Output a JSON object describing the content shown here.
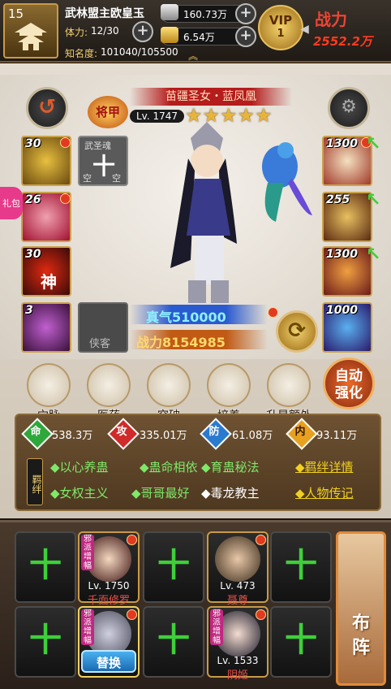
{
  "player": {
    "level": "15",
    "name": "武林盟主欧皇玉",
    "stamina_label": "体力:",
    "stamina": "12/30",
    "fame_label": "知名度:",
    "fame": "101040/105500",
    "silver": "160.73万",
    "gold": "6.54万",
    "vip_label": "VIP",
    "vip_level": "1",
    "power_logo": "战力",
    "power": "2552.2万"
  },
  "hero": {
    "title": "苗疆圣女・蓝凤凰",
    "badge": "将甲",
    "level": "Lv. 1747",
    "stars": 5,
    "true_qi": "真气510000",
    "combat_power": "战力8154985"
  },
  "left_slots": [
    {
      "count": "30",
      "icon": "gold-ring-icon"
    },
    {
      "count": "26",
      "icon": "skull-icon"
    },
    {
      "count": "30",
      "icon": "divine-slash-icon",
      "text": "神"
    },
    {
      "count": "3",
      "icon": "purple-orb-icon"
    }
  ],
  "spirit_slot": {
    "label": "武圣魂",
    "empty": "空",
    "plus": "十"
  },
  "gift_label": "礼包",
  "right_slots": [
    {
      "count": "1300",
      "icon": "feather-icon"
    },
    {
      "count": "255",
      "icon": "armor-icon"
    },
    {
      "count": "1300",
      "icon": "mirror-icon"
    },
    {
      "count": "1000",
      "icon": "phoenix-icon"
    }
  ],
  "guest_slot": "侠客",
  "actions": [
    {
      "label": "穴脉",
      "icon": "meridian-icon"
    },
    {
      "label": "医药",
      "icon": "medicine-icon"
    },
    {
      "label": "突破",
      "icon": "breakthrough-icon"
    },
    {
      "label": "培养",
      "icon": "cultivate-icon"
    },
    {
      "label": "升星额外",
      "icon": "star-up-icon"
    }
  ],
  "auto_enhance": "自动\n强化",
  "stats": [
    {
      "char": "命",
      "value": "538.3万",
      "color": "#2ea83a"
    },
    {
      "char": "攻",
      "value": "335.01万",
      "color": "#d02a2a"
    },
    {
      "char": "防",
      "value": "61.08万",
      "color": "#2a7ad0"
    },
    {
      "char": "内",
      "value": "93.11万",
      "color": "#e8a020"
    }
  ],
  "bonds_label": "羁绊",
  "bonds": [
    {
      "text": "◆以心养蛊",
      "active": true
    },
    {
      "text": "◆蛊命相依",
      "active": true
    },
    {
      "text": "◆育蛊秘法",
      "active": true
    },
    {
      "text": "◆女权主义",
      "active": true
    },
    {
      "text": "◆哥哥最好",
      "active": true
    },
    {
      "text": "◆毒龙教主",
      "active": false
    }
  ],
  "links": {
    "bond_detail": "◆羁绊详情",
    "biography": "◆人物传记"
  },
  "team": [
    {
      "empty": true
    },
    {
      "empty": false,
      "level": "Lv. 1750",
      "name": "千面修罗",
      "tag": "邪派增幅"
    },
    {
      "empty": true
    },
    {
      "empty": false,
      "level": "Lv. 473",
      "name": "聂尊",
      "tag": ""
    },
    {
      "empty": true
    },
    {
      "empty": true
    },
    {
      "empty": false,
      "level": "",
      "name": "",
      "tag": "邪派增幅",
      "replace": "替换"
    },
    {
      "empty": true
    },
    {
      "empty": false,
      "level": "Lv. 1533",
      "name": "阴姬",
      "tag": "邪派增幅"
    },
    {
      "empty": true
    }
  ],
  "formation": "布\n阵",
  "plus_glyph": "十",
  "colors": {
    "accent": "#c89a48",
    "power": "#ff3a20",
    "bond_active": "#7fe86a",
    "bond_link": "#f0d020"
  }
}
